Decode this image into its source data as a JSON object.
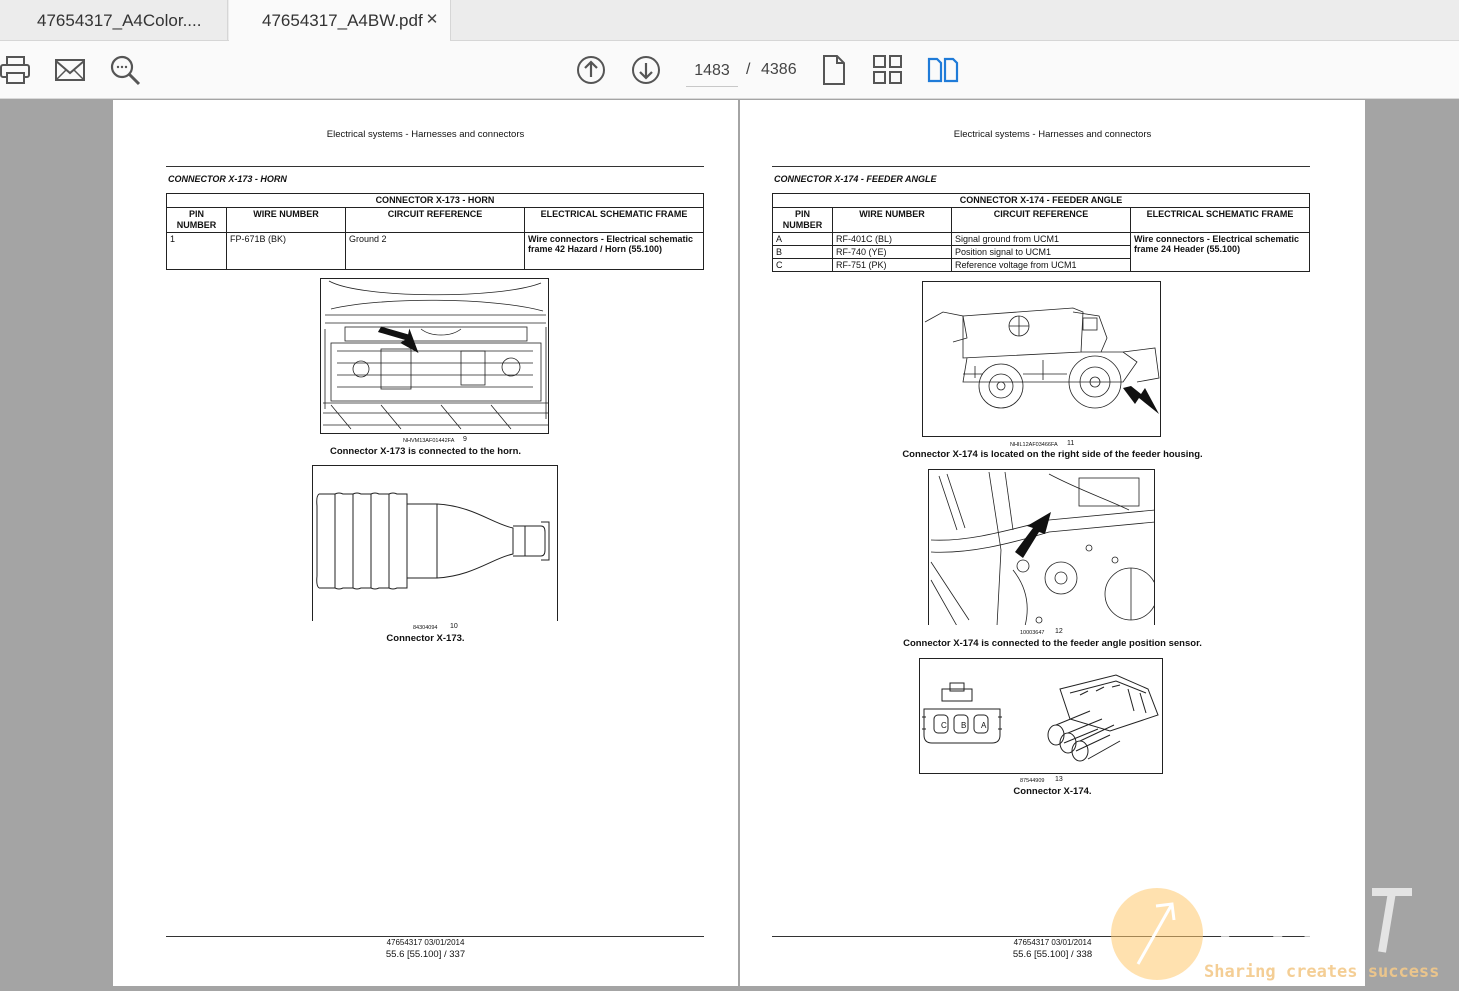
{
  "tabs": [
    {
      "label": "47654317_A4Color...."
    },
    {
      "label": "47654317_A4BW.pdf",
      "close": "✕"
    }
  ],
  "toolbar": {
    "icons": [
      "print-icon",
      "mail-icon",
      "zoom-icon",
      "page-up-icon",
      "page-down-icon",
      "single-page-icon",
      "thumbnails-icon",
      "two-page-icon"
    ],
    "current_page": "1483",
    "separator": "/",
    "total_pages": "4386",
    "accent": "#1f7bd8"
  },
  "left_page": {
    "running_head": "Electrical systems - Harnesses and connectors",
    "section_title": "CONNECTOR X-173 - HORN",
    "table": {
      "title": "CONNECTOR X-173 - HORN",
      "headers": [
        "PIN NUMBER",
        "WIRE NUMBER",
        "CIRCUIT REFERENCE",
        "ELECTRICAL SCHEMATIC FRAME"
      ],
      "rows": [
        {
          "pin": "1",
          "wire": "FP-671B (BK)",
          "circuit": "Ground 2",
          "frame": "Wire connectors - Electrical schematic frame 42 Hazard / Horn (55.100)"
        }
      ]
    },
    "fig9": {
      "code": "NHVM13AF01442FA",
      "num": "9",
      "caption": "Connector X-173 is connected to the horn."
    },
    "fig10": {
      "code": "84304094",
      "num": "10",
      "caption": "Connector X-173."
    },
    "footer_doc": "47654317 03/01/2014",
    "footer_page": "55.6 [55.100] / 337"
  },
  "right_page": {
    "running_head": "Electrical systems - Harnesses and connectors",
    "section_title": "CONNECTOR X-174 - FEEDER ANGLE",
    "table": {
      "title": "CONNECTOR X-174 - FEEDER ANGLE",
      "headers": [
        "PIN NUMBER",
        "WIRE NUMBER",
        "CIRCUIT REFERENCE",
        "ELECTRICAL SCHEMATIC FRAME"
      ],
      "rows": [
        {
          "pin": "A",
          "wire": "RF-401C (BL)",
          "circuit": "Signal ground from UCM1"
        },
        {
          "pin": "B",
          "wire": "RF-740 (YE)",
          "circuit": "Position signal to UCM1"
        },
        {
          "pin": "C",
          "wire": "RF-751 (PK)",
          "circuit": "Reference voltage from UCM1"
        }
      ],
      "frame": "Wire connectors - Electrical schematic frame 24 Header (55.100)"
    },
    "fig11": {
      "code": "NHIL12AF03466FA",
      "num": "11",
      "caption": "Connector X-174 is located on the right side of the feeder housing."
    },
    "fig12": {
      "code": "10003647",
      "num": "12",
      "caption": "Connector X-174 is connected to the feeder angle position sensor."
    },
    "fig13": {
      "code": "87544909",
      "num": "13",
      "caption": "Connector X-174.",
      "pin_letters": [
        "C",
        "B",
        "A"
      ]
    },
    "footer_doc": "47654317 03/01/2014",
    "footer_page": "55.6 [55.100] / 338"
  },
  "watermark": {
    "tagline": "Sharing creates success"
  }
}
